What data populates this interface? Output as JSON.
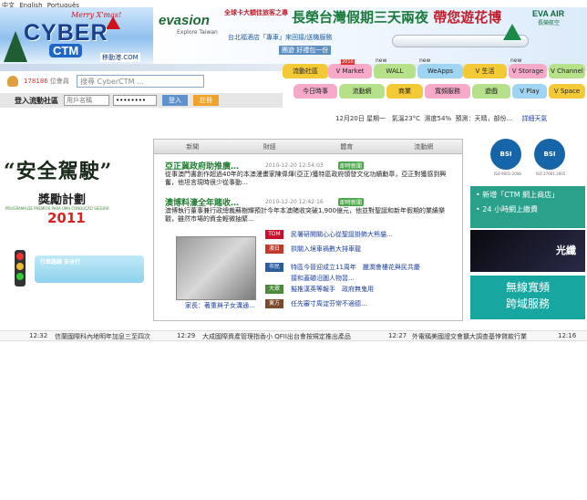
{
  "lang": [
    "中文",
    "English",
    "Português"
  ],
  "logo": {
    "greeting": "Merry X'mas!",
    "brand": "CYBER",
    "sub": "CTM",
    "site": "移動港.COM"
  },
  "ad": {
    "evasion": "evasion",
    "evasion_sub": "Explore Taiwan",
    "head_small": "全球卡大額佳旅客之專",
    "head_big_a": "長榮台灣假期三天兩夜 ",
    "head_big_b": "帶您遊花博",
    "sub1": "台北福酒店「專車」來回接/送機服務",
    "sub2": "團遊 好禮包一份",
    "airline": "EVA AIR",
    "airline_cn": "長榮航空"
  },
  "user": {
    "count": "178186",
    "count_label": "位會員"
  },
  "search": {
    "value": "搜尋 CyberCTM ..."
  },
  "login": {
    "title": "登入流動社區",
    "username_placeholder": "用戶名稱",
    "password_value": "••••••••",
    "login_btn": "登入",
    "register_btn": "註冊"
  },
  "tabs": [
    {
      "label": "流動社區",
      "color": "#f4c936",
      "new": "",
      "flag": ""
    },
    {
      "label": "V Market",
      "color": "#f7a9c9",
      "new": "",
      "flag": "2010"
    },
    {
      "label": "WALL",
      "color": "#b7e08a",
      "new": "new",
      "flag": ""
    },
    {
      "label": "WeApps",
      "color": "#9fd5f2",
      "new": "new",
      "flag": ""
    },
    {
      "label": "V 生活",
      "color": "#f4c936",
      "new": "",
      "flag": ""
    },
    {
      "label": "V Storage",
      "color": "#f7a9c9",
      "new": "new",
      "flag": ""
    },
    {
      "label": "V Channel",
      "color": "#b7e08a",
      "new": "",
      "flag": ""
    },
    {
      "label": "今日時事",
      "color": "#f7a9c9",
      "new": "",
      "flag": ""
    },
    {
      "label": "流動網",
      "color": "#b7e08a",
      "new": "",
      "flag": ""
    },
    {
      "label": "商業",
      "color": "#f4c936",
      "new": "",
      "flag": ""
    },
    {
      "label": "寬頻服務",
      "color": "#f7a9c9",
      "new": "",
      "flag": ""
    },
    {
      "label": "遊戲",
      "color": "#b7e08a",
      "new": "",
      "flag": ""
    },
    {
      "label": "V Play",
      "color": "#9fd5f2",
      "new": "",
      "flag": ""
    },
    {
      "label": "V Space",
      "color": "#f4c936",
      "new": "",
      "flag": ""
    }
  ],
  "weather": {
    "date": "12月20日",
    "weekday": "星期一",
    "temp": "氣溫23°C",
    "humidity": "濕度54%",
    "forecast": "預測：天晴，部份...",
    "link": "詳細天氣"
  },
  "promo": {
    "title": "“安全駕駛”",
    "plan": "獎勵計劃",
    "pt": "PROGRAMA DE PRÉMIOS PARA UMA CONDUÇÃO SEGURA",
    "year": "2011",
    "road": "行車路線 安全行"
  },
  "center": {
    "tabs": [
      "新聞",
      "財經",
      "體育",
      "流動網"
    ],
    "headlines": [
      {
        "title": "亞正冀政府助推廣…",
        "time": "2010-12-20 12:54:03",
        "badge": "即時新聞",
        "summary": "從事澳門書創作超過40年的本澳漫畫家陳偉煇(亞正)獲特區政府頒發文化功績勳章，亞正對獲感到興奮，他坦言現時很少從事動…"
      },
      {
        "title": "澳博料濠全年賭收…",
        "time": "2010-12-20 12:42:16",
        "badge": "即時新聞",
        "summary": "澳博執行董事兼行政總裁蘇樹輝預計今年本澳賭收突破1,900億元，他並對聖誕和新年假期的業績樂觀，雖然市場的資金輕微抽緊…"
      }
    ],
    "thumb_caption": "家長：著重與子女溝通…",
    "news": [
      {
        "tag": "TDM",
        "color": "#c8102e",
        "text": "民署研開關心心從聖誕掛飾大熊貓…"
      },
      {
        "tag": "澳日",
        "color": "#c0392b",
        "text": "拱關入境車禍數大排車龍"
      },
      {
        "tag": "市民",
        "color": "#2b5c9e",
        "text": "特區今晉迎成立11周年　麗澗會樓花與民共慶"
      },
      {
        "tag": "",
        "color": "#2b5c9e",
        "text": "接和蓋磡沿圖人物習…"
      },
      {
        "tag": "大眾",
        "color": "#4a8a3a",
        "text": "擬推漢英等報手　政府無鬼用"
      },
      {
        "tag": "東方",
        "color": "#7a4a2a",
        "text": "任先審寸周淀芬常不適德…"
      }
    ]
  },
  "right": {
    "cert1": "BSI",
    "cert1_cap": "ISO 9001:2008",
    "cert2": "BSI",
    "cert2_cap": "ISO 27001:2005",
    "line1": "• 新增「CTM 網上商店」",
    "line2": "• 24 小時網上繳費",
    "fiber": "光纖",
    "teal1": "無線寬頻",
    "teal2": "跨域服務"
  },
  "ticker": [
    {
      "time": "12:32",
      "text": "信蘭國際科內地明年加息三至四次"
    },
    {
      "time": "12:29",
      "text": "大成國際資產管理指香小 QFII出台會按規定推出產品"
    },
    {
      "time": "12:27",
      "text": "外電稱美國證交會擴大調查基悖貸款行業"
    },
    {
      "time": "12:16",
      "text": ""
    }
  ]
}
